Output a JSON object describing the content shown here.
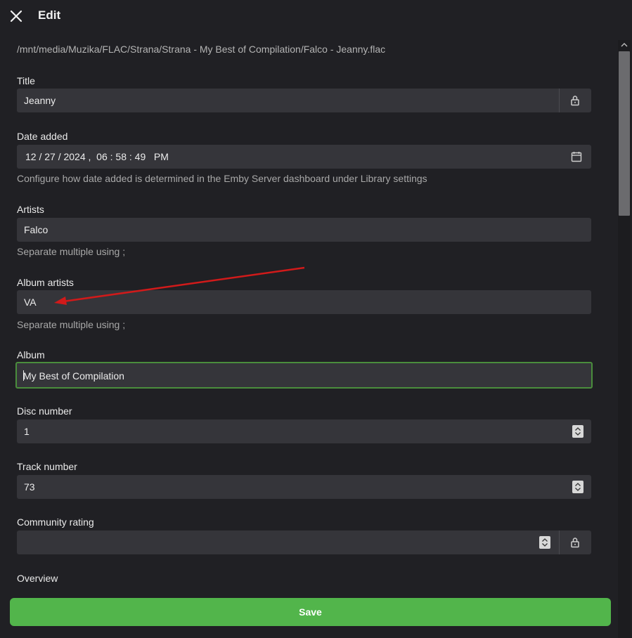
{
  "header": {
    "title": "Edit"
  },
  "file_path": "/mnt/media/Muzika/FLAC/Strana/Strana - My Best of Compilation/Falco - Jeanny.flac",
  "fields": {
    "title": {
      "label": "Title",
      "value": "Jeanny"
    },
    "date_added": {
      "label": "Date added",
      "value": "12 / 27 / 2024 ,  06 : 58 : 49   PM",
      "hint": "Configure how date added is determined in the Emby Server dashboard under Library settings"
    },
    "artists": {
      "label": "Artists",
      "value": "Falco",
      "hint": "Separate multiple using ;"
    },
    "album_artists": {
      "label": "Album artists",
      "value": "VA",
      "hint": "Separate multiple using ;"
    },
    "album": {
      "label": "Album",
      "value": "My Best of Compilation"
    },
    "disc_number": {
      "label": "Disc number",
      "value": "1"
    },
    "track_number": {
      "label": "Track number",
      "value": "73"
    },
    "community_rating": {
      "label": "Community rating",
      "value": ""
    },
    "overview": {
      "label": "Overview"
    }
  },
  "save_button": {
    "label": "Save"
  },
  "colors": {
    "accent": "#52b54b",
    "focus_border": "#4a8d3c",
    "annotation_arrow": "#d11a1a"
  },
  "icons": [
    "close-icon",
    "lock-icon",
    "calendar-icon",
    "spinner-icon"
  ]
}
